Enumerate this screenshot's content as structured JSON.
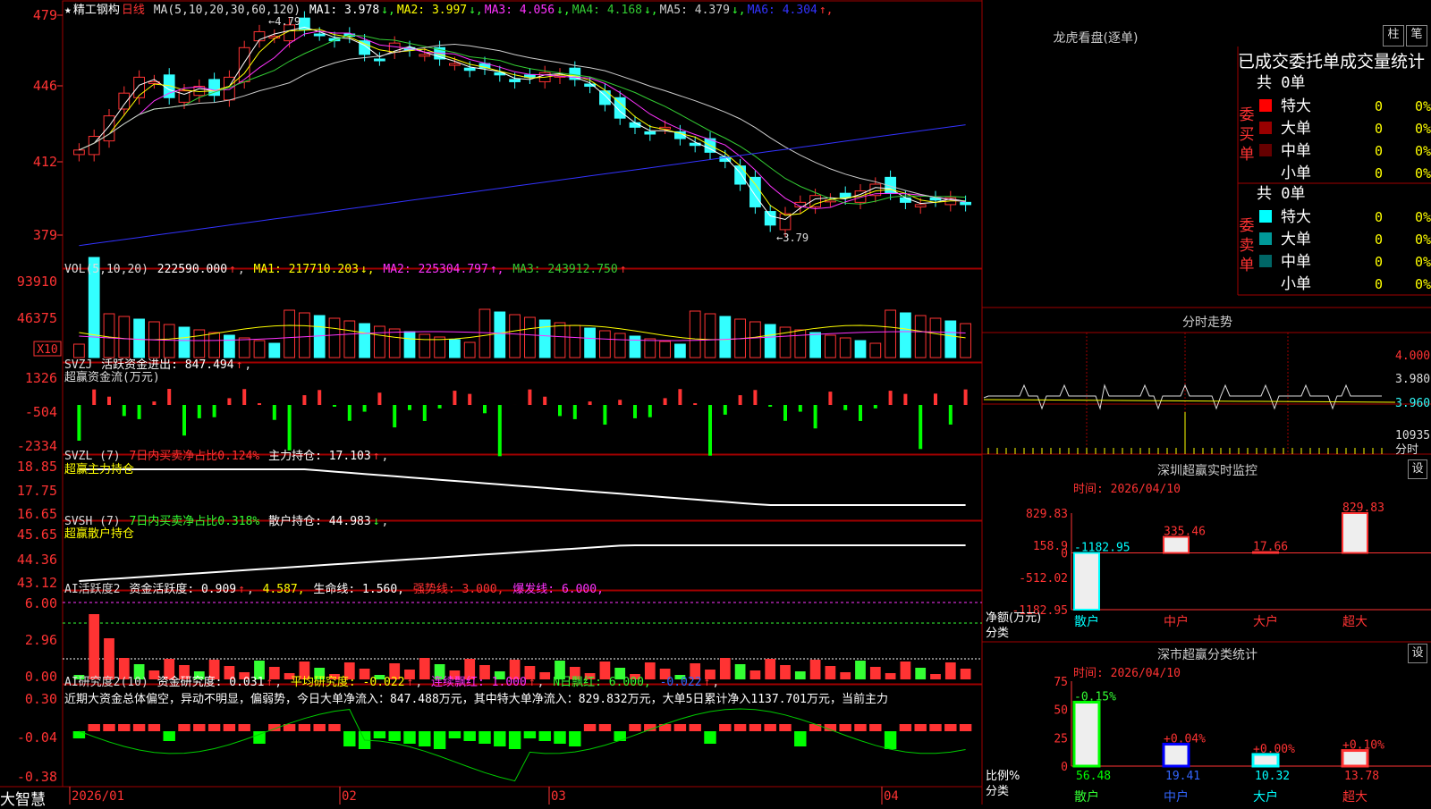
{
  "stock": {
    "star": "★",
    "name": "精工钢构",
    "period": "日线"
  },
  "colors": {
    "up": "#ff3333",
    "down": "#33ffff",
    "grid": "#a00000",
    "ma1": "#ffffff",
    "ma2": "#ffff00",
    "ma3": "#ff33ff",
    "ma4": "#33cc33",
    "ma5": "#cccccc",
    "ma6": "#3333ff"
  },
  "price_panel": {
    "ma_label": "MA(5,10,20,30,60,120)",
    "ma_values": [
      {
        "label": "MA1: 3.978",
        "arrow": "↓",
        "color": "#ffffff"
      },
      {
        "label": "MA2: 3.997",
        "arrow": "↓",
        "color": "#ffff00"
      },
      {
        "label": "MA3: 4.056",
        "arrow": "↓",
        "color": "#ff33ff"
      },
      {
        "label": "MA4: 4.168",
        "arrow": "↓",
        "color": "#33cc33"
      },
      {
        "label": "MA5: 4.379",
        "arrow": "↓",
        "color": "#cccccc"
      },
      {
        "label": "MA6: 4.304",
        "arrow": "↑",
        "color": "#3333ff"
      }
    ],
    "y_ticks": [
      "479",
      "446",
      "412",
      "379"
    ],
    "high_mark": "4.79",
    "low_mark": "3.79"
  },
  "vol_panel": {
    "label": "VOL(5,10,20)",
    "value": "222590.000",
    "ma1": "MA1: 217710.203",
    "ma2": "MA2: 225304.797",
    "ma3": "MA3: 243912.750",
    "y_ticks": [
      "93910",
      "46375"
    ],
    "unit": "X10"
  },
  "svzj_panel": {
    "label": "SVZJ",
    "name": "活跃资金进出: 847.494",
    "sub": "超赢资金流(万元)",
    "y_ticks": [
      "1326",
      "-504",
      "-2334"
    ]
  },
  "svzl_panel": {
    "label": "SVZL (7)",
    "ratio": "7日内买卖净占比0.124%",
    "hold": "主力持仓: 17.103",
    "sub": "超赢主力持仓",
    "y_ticks": [
      "18.85",
      "17.75",
      "16.65"
    ]
  },
  "svsh_panel": {
    "label": "SVSH (7)",
    "ratio": "7日内买卖净占比0.318%",
    "hold": "散户持仓: 44.983",
    "sub": "超赢散户持仓",
    "y_ticks": [
      "45.65",
      "44.36",
      "43.12"
    ]
  },
  "ai1_panel": {
    "label": "AI活跃度2",
    "text1": "资金活跃度: 0.909",
    "text2": "4.587,",
    "text3": "生命线: 1.560,",
    "text4": "强势线: 3.000,",
    "text5": "爆发线: 6.000,",
    "y_ticks": [
      "6.00",
      "2.96",
      "0.00"
    ]
  },
  "ai2_panel": {
    "label": "AI研究度2(10)",
    "text1": "资金研究度: 0.031",
    "text2": "平均研究度: -0.022",
    "text3": "连续飘红: 1.000",
    "text4": "N日飘红: 6.000,",
    "text5": "-0.022",
    "y_ticks": [
      "0.30",
      "-0.04",
      "-0.38"
    ],
    "comment": "近期大资金总体偏空，异动不明显，偏弱势，今日大单净流入：847.488万元，其中特大单净流入：829.832万元，大单5日累计净入1137.701万元，当前主力"
  },
  "date_axis": {
    "logo": "大智慧",
    "dates": [
      "2026/01",
      "02",
      "03",
      "04"
    ]
  },
  "longhu": {
    "title": "龙虎看盘(逐单)",
    "btn1": "柱",
    "btn2": "笔",
    "stat_title": "已成交委托单成交量统计",
    "buy": {
      "side": "委买单",
      "total": "共 0单",
      "rows": [
        {
          "name": "特大",
          "n": "0",
          "p": "0%",
          "color": "#ff0000"
        },
        {
          "name": "大单",
          "n": "0",
          "p": "0%",
          "color": "#990000"
        },
        {
          "name": "中单",
          "n": "0",
          "p": "0%",
          "color": "#660000"
        },
        {
          "name": "小单",
          "n": "0",
          "p": "0%",
          "color": "#000000"
        }
      ]
    },
    "sell": {
      "side": "委卖单",
      "total": "共 0单",
      "rows": [
        {
          "name": "特大",
          "n": "0",
          "p": "0%",
          "color": "#00ffff"
        },
        {
          "name": "大单",
          "n": "0",
          "p": "0%",
          "color": "#009999"
        },
        {
          "name": "中单",
          "n": "0",
          "p": "0%",
          "color": "#006666"
        },
        {
          "name": "小单",
          "n": "0",
          "p": "0%",
          "color": "#000000"
        }
      ]
    }
  },
  "intraday": {
    "title": "分时走势",
    "y_ticks": [
      "4.000",
      "3.980",
      "3.960"
    ],
    "vol": "10935",
    "vol_label": "分时"
  },
  "monitor": {
    "title": "深圳超赢实时监控",
    "btn": "设",
    "time": "时间: 2026/04/10",
    "y_ticks": [
      "829.83",
      "158.9",
      "0",
      "-512.02",
      "-1182.95"
    ],
    "axis_label": "净额(万元)",
    "cat_label": "分类",
    "chart_data": {
      "type": "bar",
      "categories": [
        "散户",
        "中户",
        "大户",
        "超大"
      ],
      "values": [
        -1182.95,
        335.46,
        17.66,
        829.83
      ],
      "ylim": [
        -1182.95,
        829.83
      ]
    },
    "labels": [
      "-1182.95",
      "335.46",
      "17.66",
      "829.83"
    ]
  },
  "classify": {
    "title": "深市超赢分类统计",
    "btn": "设",
    "time": "时间: 2026/04/10",
    "y_ticks": [
      "75",
      "50",
      "25",
      "0"
    ],
    "axis_label": "比例%",
    "cat_label": "分类",
    "chart_data": {
      "type": "bar",
      "categories": [
        "散户",
        "中户",
        "大户",
        "超大"
      ],
      "values": [
        56.48,
        19.41,
        10.32,
        13.78
      ],
      "ylim": [
        0,
        75
      ]
    },
    "changes": [
      "-0.15%",
      "+0.04%",
      "+0.00%",
      "+0.10%"
    ],
    "values_text": [
      "56.48",
      "19.41",
      "10.32",
      "13.78"
    ]
  }
}
